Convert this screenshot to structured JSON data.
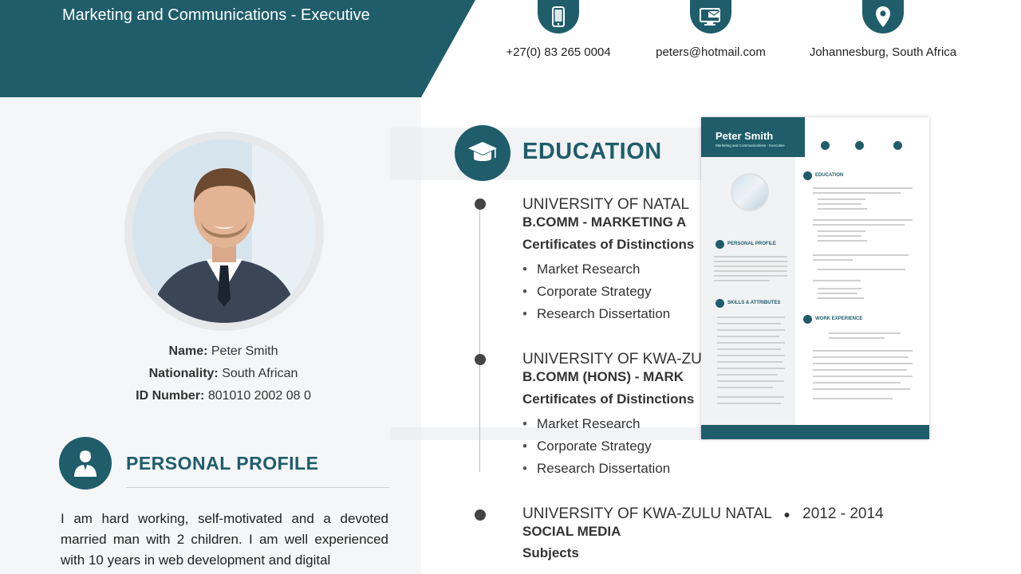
{
  "header": {
    "job_title": "Marketing and Communications - Executive"
  },
  "contact": {
    "phone": "+27(0) 83 265 0004",
    "email": "peters@hotmail.com",
    "location": "Johannesburg, South Africa"
  },
  "personal": {
    "name_label": "Name:",
    "name": "Peter Smith",
    "nationality_label": "Nationality:",
    "nationality": "South African",
    "id_label": "ID Number:",
    "id_number": "801010 2002 08 0"
  },
  "profile": {
    "title": "PERSONAL PROFILE",
    "text": "I am hard working, self-motivated and a devoted married man with 2 children. I am well experienced with 10 years in web development and digital"
  },
  "education": {
    "title": "EDUCATION",
    "entries": [
      {
        "university": "UNIVERSITY OF NATAL",
        "degree": "B.COMM - MARKETING A",
        "subheading": "Certificates of Distinctions",
        "items": [
          "Market Research",
          "Corporate Strategy",
          "Research Dissertation"
        ]
      },
      {
        "university": "UNIVERSITY OF KWA-ZU",
        "degree": "B.COMM (HONS) - MARK",
        "subheading": "Certificates of Distinctions",
        "items": [
          "Market Research",
          "Corporate Strategy",
          "Research Dissertation"
        ]
      },
      {
        "university": "UNIVERSITY OF KWA-ZULU NATAL",
        "years": "2012 - 2014",
        "degree": "SOCIAL MEDIA",
        "subheading": "Subjects"
      }
    ]
  },
  "thumbnail": {
    "name": "Peter Smith",
    "subtitle": "Marketing and Communications - Executive",
    "sections": [
      "EDUCATION",
      "PERSONAL PROFILE",
      "SKILLS & ATTRIBUTES",
      "WORK EXPERIENCE"
    ]
  },
  "colors": {
    "accent": "#1f5d6b"
  }
}
